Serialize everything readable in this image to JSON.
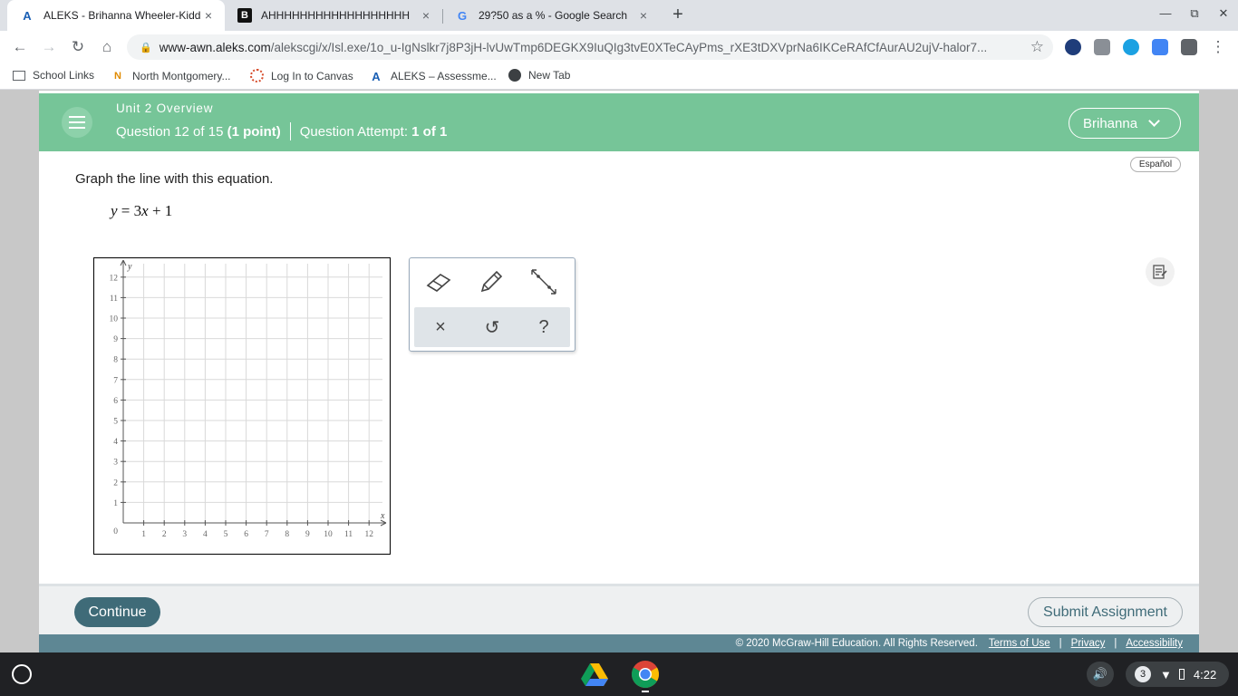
{
  "browser": {
    "tabs": [
      {
        "title": "ALEKS - Brihanna Wheeler-Kidd -",
        "favicon": "A",
        "active": true
      },
      {
        "title": "AHHHHHHHHHHHHHHHHHH",
        "favicon": "B",
        "active": false
      },
      {
        "title": "29?50 as a % - Google Search",
        "favicon": "G",
        "active": false
      }
    ],
    "close_glyph": "×",
    "new_tab_glyph": "+",
    "url_host": "www-awn.aleks.com",
    "url_path": "/alekscgi/x/Isl.exe/1o_u-IgNslkr7j8P3jH-lvUwTmp6DEGKX9IuQIg3tvE0XTeCAyPms_rXE3tDXVprNa6IKCeRAfCfAurAU2ujV-halor7...",
    "bookmarks": [
      "School Links",
      "North Montgomery...",
      "Log In to Canvas",
      "ALEKS – Assessme...",
      "New Tab"
    ]
  },
  "header": {
    "unit_title": "Unit 2 Overview",
    "question_prefix": "Question 12 of 15",
    "question_points": "(1 point)",
    "attempt_label": "Question Attempt:",
    "attempt_value": "1 of 1",
    "user_name": "Brihanna",
    "bg_color": "#76c598"
  },
  "main": {
    "espanol": "Español",
    "prompt": "Graph the line with this equation.",
    "equation": {
      "y": "y",
      "eq": " = 3",
      "x": "x",
      "tail": " + 1"
    }
  },
  "graph": {
    "x_label": "x",
    "y_label": "y",
    "origin_label": "0",
    "x_ticks": [
      "1",
      "2",
      "3",
      "4",
      "5",
      "6",
      "7",
      "8",
      "9",
      "10",
      "11",
      "12"
    ],
    "y_ticks": [
      "1",
      "2",
      "3",
      "4",
      "5",
      "6",
      "7",
      "8",
      "9",
      "10",
      "11",
      "12"
    ]
  },
  "toolbox": {
    "tools": [
      "eraser-icon",
      "pencil-icon",
      "line-tool-icon"
    ],
    "actions": {
      "clear": "×",
      "undo": "↺",
      "help": "?"
    }
  },
  "footer": {
    "continue_label": "Continue",
    "submit_label": "Submit Assignment",
    "copyright": "© 2020 McGraw-Hill Education. All Rights Reserved.",
    "terms": "Terms of Use",
    "privacy": "Privacy",
    "accessibility": "Accessibility",
    "separator": "|"
  },
  "shelf": {
    "notification_count": "3",
    "time": "4:22"
  }
}
